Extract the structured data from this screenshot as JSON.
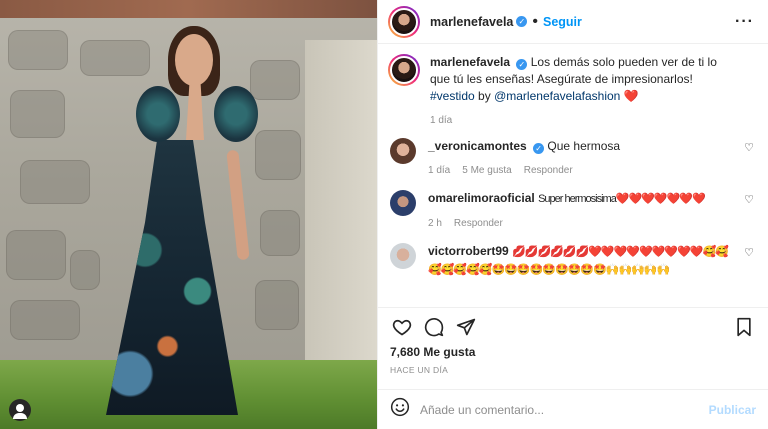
{
  "header": {
    "username": "marlenefavela",
    "dot": "•",
    "follow_label": "Seguir",
    "more_icon": "..."
  },
  "caption": {
    "username": "marlenefavela",
    "text": "Los demás solo pueden ver de ti lo que tú les enseñas! Asegúrate de impresionarlos!",
    "hashtag": "#vestido",
    "by": "by",
    "mention": "@marlenefavelafashion",
    "emoji": "❤️",
    "time": "1 día"
  },
  "comments": [
    {
      "username": "_veronicamontes",
      "verified": true,
      "text": "Que hermosa",
      "time": "1 día",
      "likes": "5 Me gusta",
      "reply": "Responder"
    },
    {
      "username": "omarelimoraoficial",
      "verified": false,
      "text": "Super hermosisima❤️❤️❤️❤️❤️❤️❤️",
      "time": "2 h",
      "reply": "Responder"
    },
    {
      "username": "victorrobert99",
      "verified": false,
      "text": "💋💋💋💋💋💋❤️❤️❤️❤️❤️❤️❤️❤️❤️🥰🥰🥰🥰🥰🥰🥰🤩🤩🤩🤩🤩🤩🤩🤩🤩🙌🙌🙌🙌🙌"
    }
  ],
  "stats": {
    "likes": "7,680 Me gusta",
    "time_ago": "HACE UN DÍA"
  },
  "composer": {
    "placeholder": "Añade un comentario...",
    "post_label": "Publicar"
  },
  "colors": {
    "accent": "#0095f6",
    "verified": "#3897f0",
    "heart": "#ed4956",
    "muted": "#8e8e8e"
  },
  "icons": {
    "like": "heart-outline-icon",
    "comment": "comment-icon",
    "share": "paper-plane-icon",
    "save": "bookmark-icon",
    "emoji": "smiley-icon",
    "user_tag": "user-tag-icon"
  }
}
